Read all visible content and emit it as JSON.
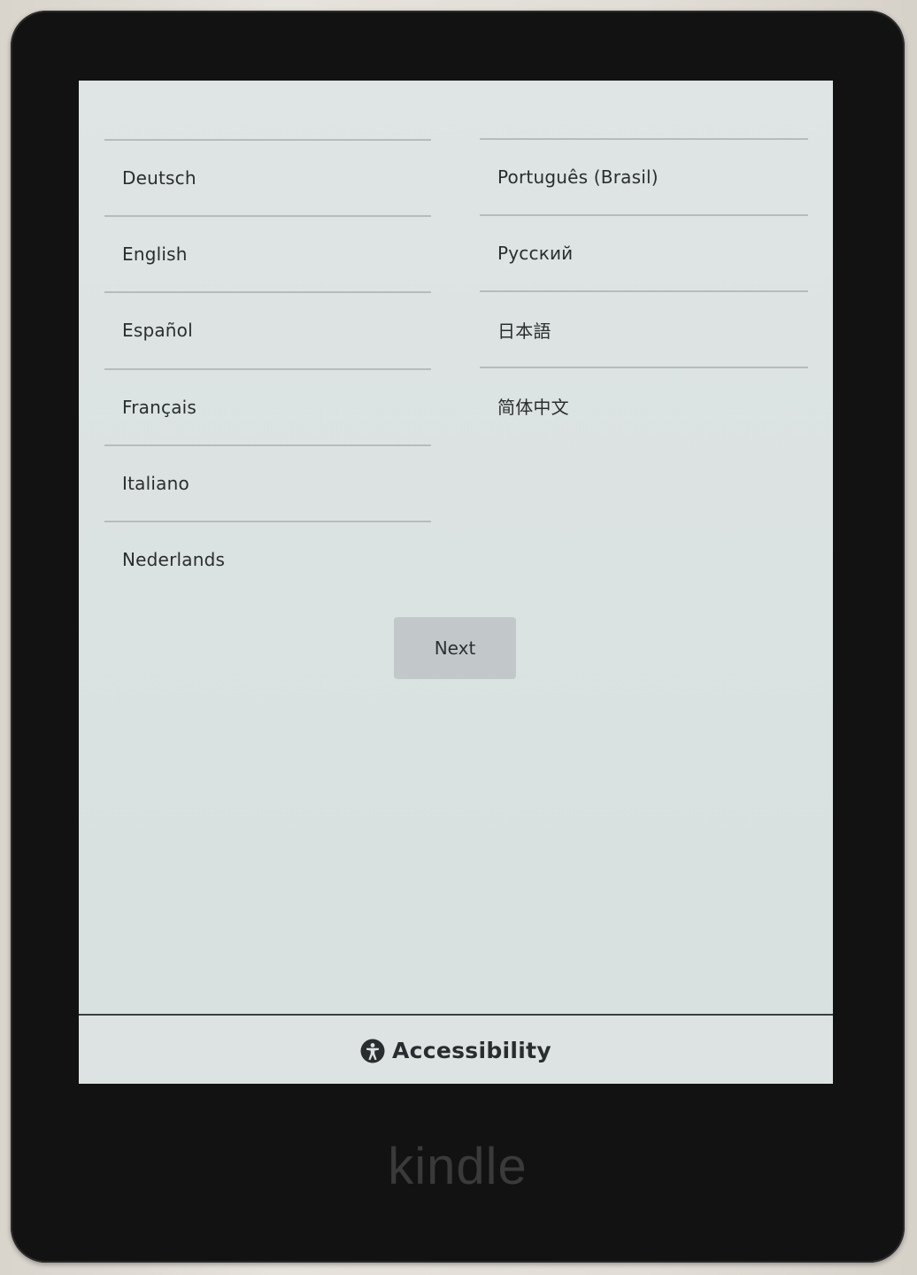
{
  "languages_left": [
    {
      "label": "Deutsch"
    },
    {
      "label": "English"
    },
    {
      "label": "Español"
    },
    {
      "label": "Français"
    },
    {
      "label": "Italiano"
    },
    {
      "label": "Nederlands"
    }
  ],
  "languages_right": [
    {
      "label": "Português (Brasil)"
    },
    {
      "label": "Русский"
    },
    {
      "label": "日本語"
    },
    {
      "label": "简体中文"
    }
  ],
  "next_button": {
    "label": "Next"
  },
  "accessibility": {
    "label": "Accessibility",
    "icon": "accessibility-icon"
  },
  "device": {
    "brand": "kindle"
  }
}
